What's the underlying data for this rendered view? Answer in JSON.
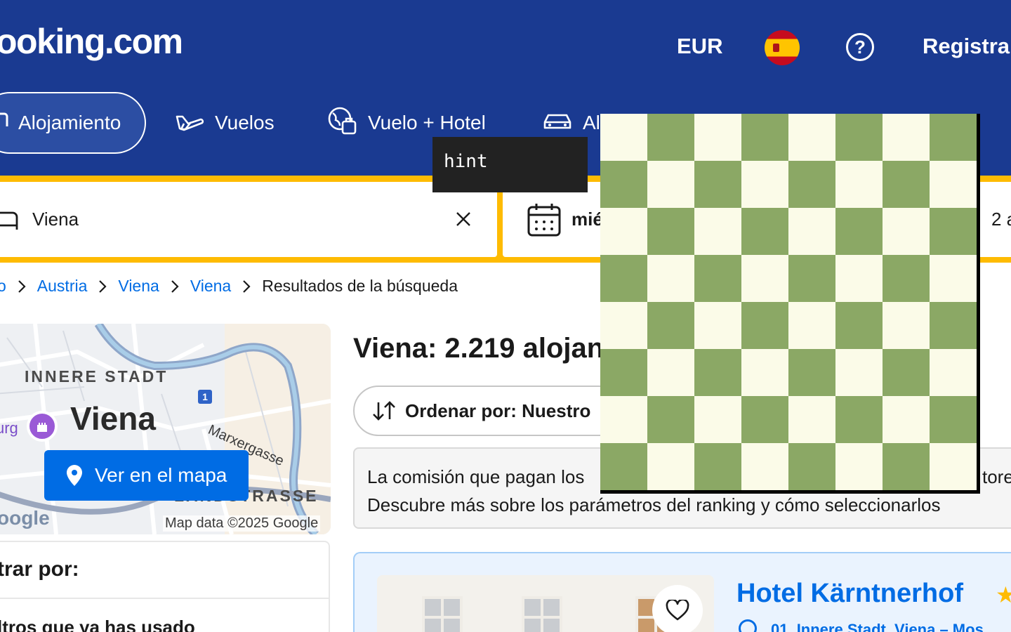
{
  "header": {
    "logo": "ooking.com",
    "currency": "EUR",
    "flag_icon": "spain-flag-icon",
    "help_label": "?",
    "register_label": "Registra"
  },
  "nav": {
    "items": [
      {
        "label": "Alojamiento",
        "icon": "bed-icon",
        "active": true
      },
      {
        "label": "Vuelos",
        "icon": "plane-icon",
        "active": false
      },
      {
        "label": "Vuelo + Hotel",
        "icon": "globe-suitcase-icon",
        "active": false
      },
      {
        "label": "Al",
        "icon": "car-icon",
        "active": false
      }
    ]
  },
  "search": {
    "destination_value": "Viena",
    "date_value": "mié",
    "guests_value": "2 a"
  },
  "breadcrumb": {
    "lead": "o",
    "items": [
      "Austria",
      "Viena",
      "Viena"
    ],
    "current": "Resultados de la búsqueda"
  },
  "map": {
    "district_label": "INNERE STADT",
    "city_label": "Viena",
    "street_label": "Marxergasse",
    "street_label_2": "LANDSTRASSE",
    "route_badge": "1",
    "left_fragment": "urg",
    "google_mark": "oogle",
    "credit": "Map data ©2025 Google",
    "button_label": "Ver en el mapa"
  },
  "filters": {
    "title": "trar por:",
    "subtitle": "ltros que ya has usado"
  },
  "results": {
    "title": "Viena: 2.219 alojan",
    "sort_label": "Ordenar por: Nuestro",
    "info_line_1": "La comisión que pagan los",
    "info_line_1_tail": "tore",
    "info_line_2": "Descubre más sobre los parámetros del ranking y cómo seleccionarlos"
  },
  "hotel": {
    "name": "Hotel Kärntnerhof",
    "star": "★",
    "location": "01. Innere Stadt, Viena – Mos"
  },
  "tooltip": {
    "text": "hint"
  },
  "colors": {
    "brand_blue": "#1a3a91",
    "accent_yellow": "#febb02",
    "link_blue": "#006ce4",
    "board_light": "#fbfbe8",
    "board_dark": "#8ba865"
  }
}
